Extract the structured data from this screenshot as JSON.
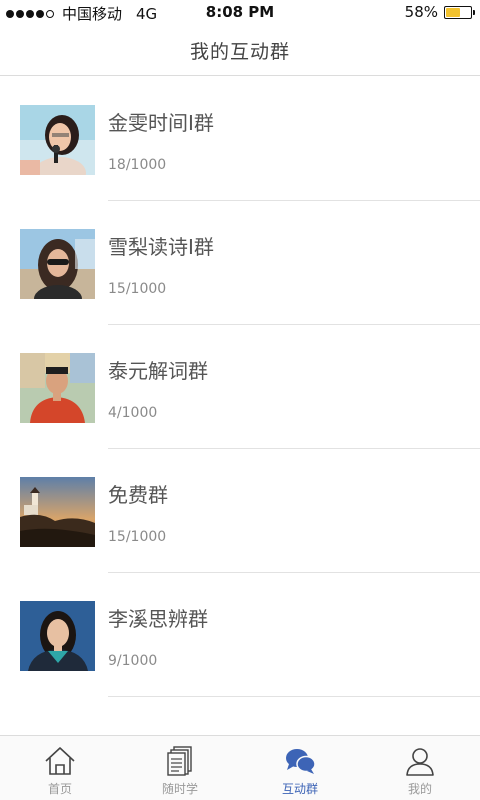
{
  "status_bar": {
    "carrier": "中国移动",
    "network": "4G",
    "time": "8:08 PM",
    "battery_percent": "58%",
    "battery_level": 0.58,
    "signal_bars": 4,
    "battery_color": "#f2c22e"
  },
  "header": {
    "title": "我的互动群"
  },
  "groups": [
    {
      "name": "金雯时间I群",
      "count": "18/1000",
      "avatar": "woman-speaking-photo"
    },
    {
      "name": "雪梨读诗I群",
      "count": "15/1000",
      "avatar": "woman-sunglasses-photo"
    },
    {
      "name": "泰元解词群",
      "count": "4/1000",
      "avatar": "man-map-photo"
    },
    {
      "name": "免费群",
      "count": "15/1000",
      "avatar": "lighthouse-photo"
    },
    {
      "name": "李溪思辨群",
      "count": "9/1000",
      "avatar": "woman-portrait-photo"
    }
  ],
  "tabs": [
    {
      "label": "首页",
      "icon": "house-icon",
      "active": false
    },
    {
      "label": "随时学",
      "icon": "pages-icon",
      "active": false
    },
    {
      "label": "互动群",
      "icon": "chat-bubbles-icon",
      "active": true
    },
    {
      "label": "我的",
      "icon": "person-icon",
      "active": false
    }
  ],
  "colors": {
    "accent": "#3d64b6",
    "tab_inactive": "#999999"
  }
}
